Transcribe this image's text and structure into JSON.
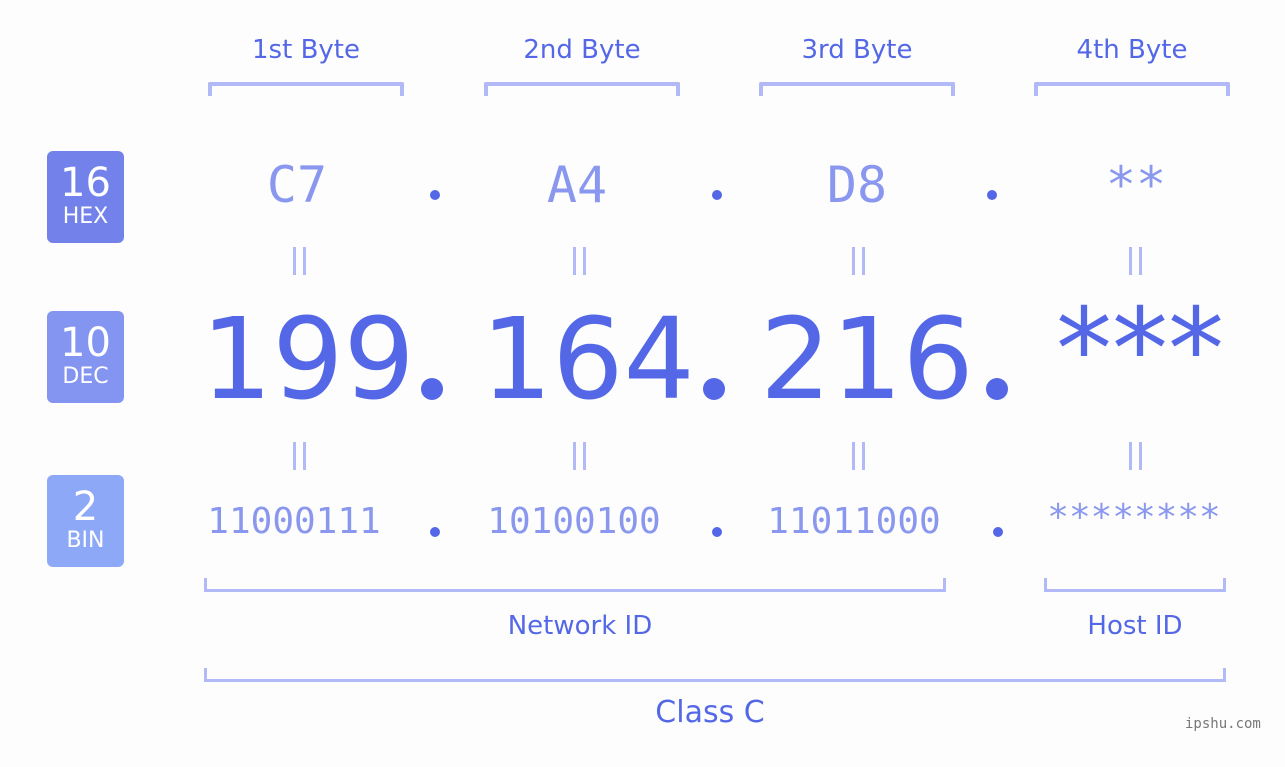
{
  "bytes": [
    {
      "label": "1st Byte",
      "hex": "C7",
      "dec": "199",
      "bin": "11000111"
    },
    {
      "label": "2nd Byte",
      "hex": "A4",
      "dec": "164",
      "bin": "10100100"
    },
    {
      "label": "3rd Byte",
      "hex": "D8",
      "dec": "216",
      "bin": "11011000"
    },
    {
      "label": "4th Byte",
      "hex": "**",
      "dec": "***",
      "bin": "********"
    }
  ],
  "radix": {
    "hex": {
      "base": "16",
      "name": "HEX"
    },
    "dec": {
      "base": "10",
      "name": "DEC"
    },
    "bin": {
      "base": "2",
      "name": "BIN"
    }
  },
  "sections": {
    "network": "Network ID",
    "host": "Host ID",
    "class": "Class C"
  },
  "watermark": "ipshu.com",
  "colors": {
    "accent": "#5468e7",
    "light": "#8a97ef",
    "bracket": "#b1b9f7",
    "hex_badge": "#7382ea",
    "dec_badge": "#8394f1",
    "bin_badge": "#8ea8f8"
  }
}
